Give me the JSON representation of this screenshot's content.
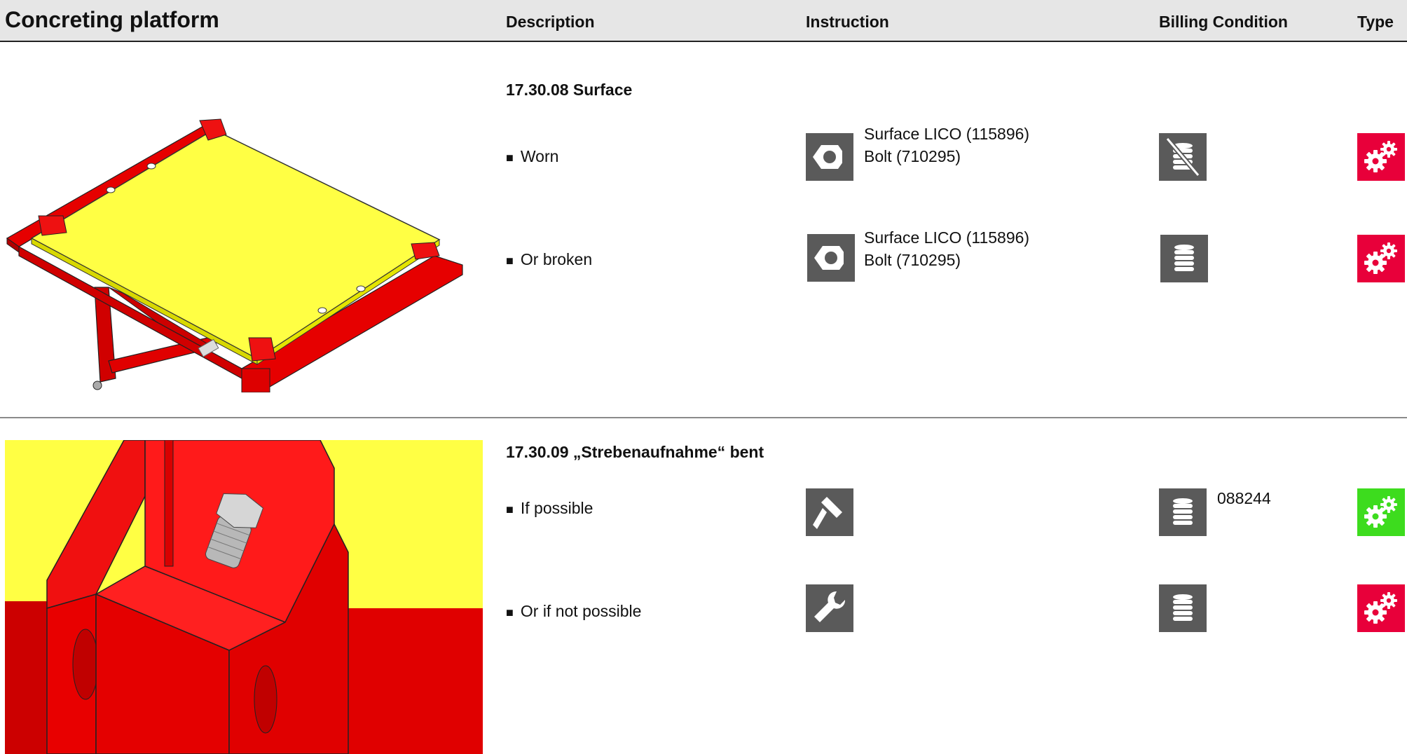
{
  "header": {
    "title": "Concreting platform",
    "col_description": "Description",
    "col_instruction": "Instruction",
    "col_billing": "Billing Condition",
    "col_type": "Type"
  },
  "sections": [
    {
      "title": "17.30.08 Surface",
      "rows": [
        {
          "bullet": "■",
          "description": "Worn",
          "instruction_icon": "nut-icon",
          "instruction_line1": "Surface LICO (115896)",
          "instruction_line2": "Bolt (710295)",
          "billing_icon": "coins-crossed-icon",
          "billing_text": "",
          "type_icon": "gears-icon",
          "type_color": "#e8003a"
        },
        {
          "bullet": "■",
          "description": "Or broken",
          "instruction_icon": "nut-icon",
          "instruction_line1": "Surface LICO (115896)",
          "instruction_line2": "Bolt (710295)",
          "billing_icon": "coins-icon",
          "billing_text": "",
          "type_icon": "gears-icon",
          "type_color": "#e8003a"
        }
      ]
    },
    {
      "title": "17.30.09 „Strebenaufnahme“ bent",
      "rows": [
        {
          "bullet": "■",
          "description": "If possible",
          "instruction_icon": "hammer-icon",
          "instruction_line1": "",
          "instruction_line2": "",
          "billing_icon": "coins-icon",
          "billing_text": "088244",
          "type_icon": "gears-icon",
          "type_color": "#3ddc1e"
        },
        {
          "bullet": "■",
          "description": "Or if not possible",
          "instruction_icon": "wrench-icon",
          "instruction_line1": "",
          "instruction_line2": "",
          "billing_icon": "coins-icon",
          "billing_text": "",
          "type_icon": "gears-icon",
          "type_color": "#e8003a"
        }
      ]
    }
  ],
  "colors": {
    "header_bg": "#e6e6e6",
    "icon_bg": "#5a5a5a",
    "type_red": "#e8003a",
    "type_green": "#3ddc1e",
    "part_red": "#ee1111",
    "part_yellow": "#ffff44"
  }
}
